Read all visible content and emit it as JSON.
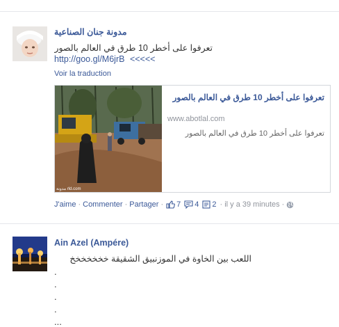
{
  "post1": {
    "author": "مدونة جنان الصناعية",
    "text": "تعرفوا على أخطر 10 طرق في العالم بالصور",
    "link": "http://goo.gl/M6jrB",
    "arrows": "<<<<<",
    "translate": "Voir la traduction",
    "share": {
      "title": "تعرفوا على أخطر 10 طرق في العالم بالصور",
      "domain": "www.abotlal.com",
      "description": "تعرفوا على أخطر 10 طرق في العالم بالصور",
      "watermark": "مدونة rld.com"
    },
    "actions": {
      "like": "J'aime",
      "comment": "Commenter",
      "share": "Partager",
      "likes_count": "7",
      "comments_count": "4",
      "shares_count": "2",
      "time": "il y a 39 minutes"
    }
  },
  "post2": {
    "author": "Ain Azel (Ampére)",
    "text": "اللعب بين الخاوة في الموزنبيق الشقيقة خخخخخخخ",
    "lines": [
      ".",
      ".",
      ".",
      ".",
      "..."
    ]
  },
  "icons": {
    "like": "thumbs-up-icon",
    "comment": "comment-bubble-icon",
    "share": "share-page-icon",
    "privacy": "globe-icon"
  },
  "colors": {
    "link": "#3b5998",
    "meta": "#90949c"
  }
}
